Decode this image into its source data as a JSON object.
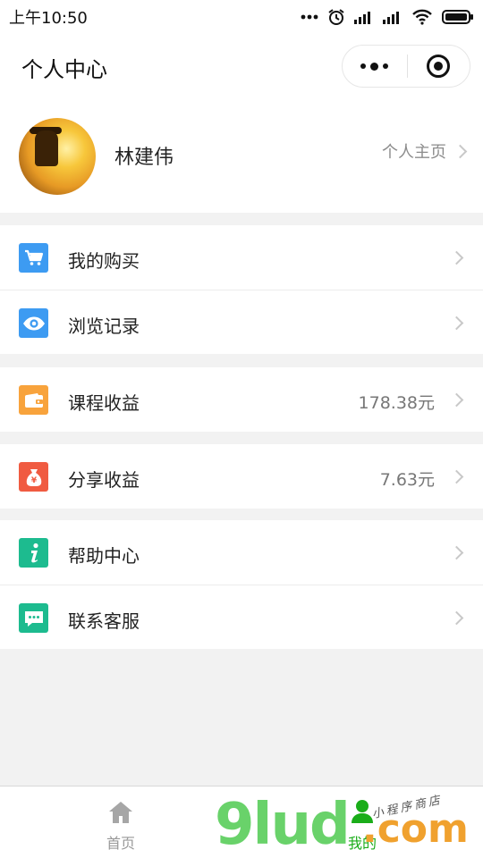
{
  "status_bar": {
    "time": "上午10:50"
  },
  "nav": {
    "title": "个人中心"
  },
  "profile": {
    "name": "林建伟",
    "homepage_label": "个人主页"
  },
  "menu": {
    "purchases": {
      "label": "我的购买",
      "icon": "cart-icon",
      "color": "#3d9bf2"
    },
    "history": {
      "label": "浏览记录",
      "icon": "eye-icon",
      "color": "#3d9bf2"
    },
    "course_income": {
      "label": "课程收益",
      "value": "178.38元",
      "icon": "wallet-icon",
      "color": "#f8a33c"
    },
    "share_income": {
      "label": "分享收益",
      "value": "7.63元",
      "icon": "money-bag-icon",
      "color": "#f05b41"
    },
    "help": {
      "label": "帮助中心",
      "icon": "info-icon",
      "color": "#1dbb8f"
    },
    "support": {
      "label": "联系客服",
      "icon": "chat-icon",
      "color": "#1dbb8f"
    }
  },
  "tabbar": {
    "home_label": "首页",
    "mine_label": "我的",
    "active_color": "#1aad19"
  },
  "watermark": {
    "text": "9lud",
    "suffix": ".com",
    "tagline": "小程序商店"
  }
}
